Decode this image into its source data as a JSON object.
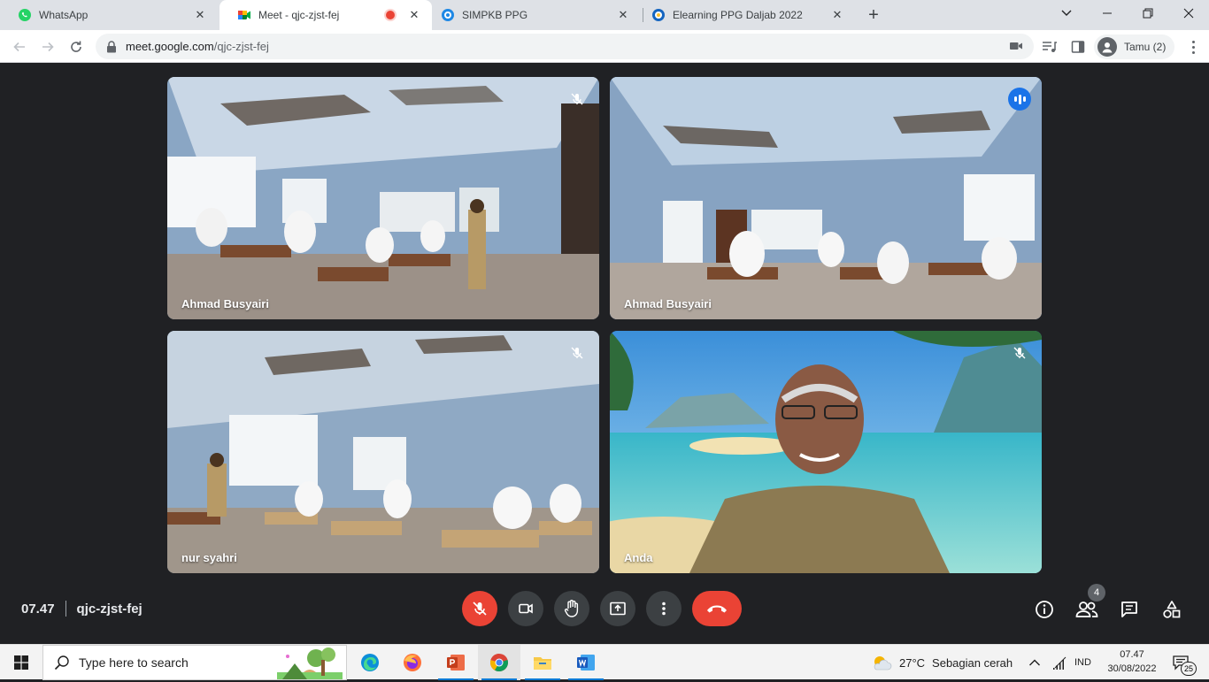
{
  "browser": {
    "tabs": [
      {
        "title": "WhatsApp",
        "icon": "whatsapp-icon",
        "active": false
      },
      {
        "title": "Meet - qjc-zjst-fej",
        "icon": "google-meet-icon",
        "active": true
      },
      {
        "title": "SIMPKB PPG",
        "icon": "simpkb-icon",
        "active": false
      },
      {
        "title": "Elearning PPG Daljab 2022",
        "icon": "elearning-icon",
        "active": false
      }
    ],
    "url_host": "meet.google.com",
    "url_path": "/qjc-zjst-fej",
    "profile_label": "Tamu (2)"
  },
  "meet": {
    "tiles": [
      {
        "name": "Ahmad Busyairi",
        "muted": true,
        "speaking": false
      },
      {
        "name": "Ahmad Busyairi",
        "muted": false,
        "speaking": true
      },
      {
        "name": "nur syahri",
        "muted": true,
        "speaking": false
      },
      {
        "name": "Anda",
        "muted": true,
        "speaking": false
      }
    ],
    "time": "07.47",
    "meeting_code": "qjc-zjst-fej",
    "participants_count": "4",
    "colors": {
      "end_call": "#ea4335",
      "mic_off": "#ea4335",
      "speaking": "#1a73e8",
      "active_border": "#8ab4f8"
    }
  },
  "taskbar": {
    "search_placeholder": "Type here to search",
    "weather_temp": "27°C",
    "weather_text": "Sebagian cerah",
    "language": "IND",
    "clock_time": "07.47",
    "clock_date": "30/08/2022",
    "notification_count": "25"
  }
}
